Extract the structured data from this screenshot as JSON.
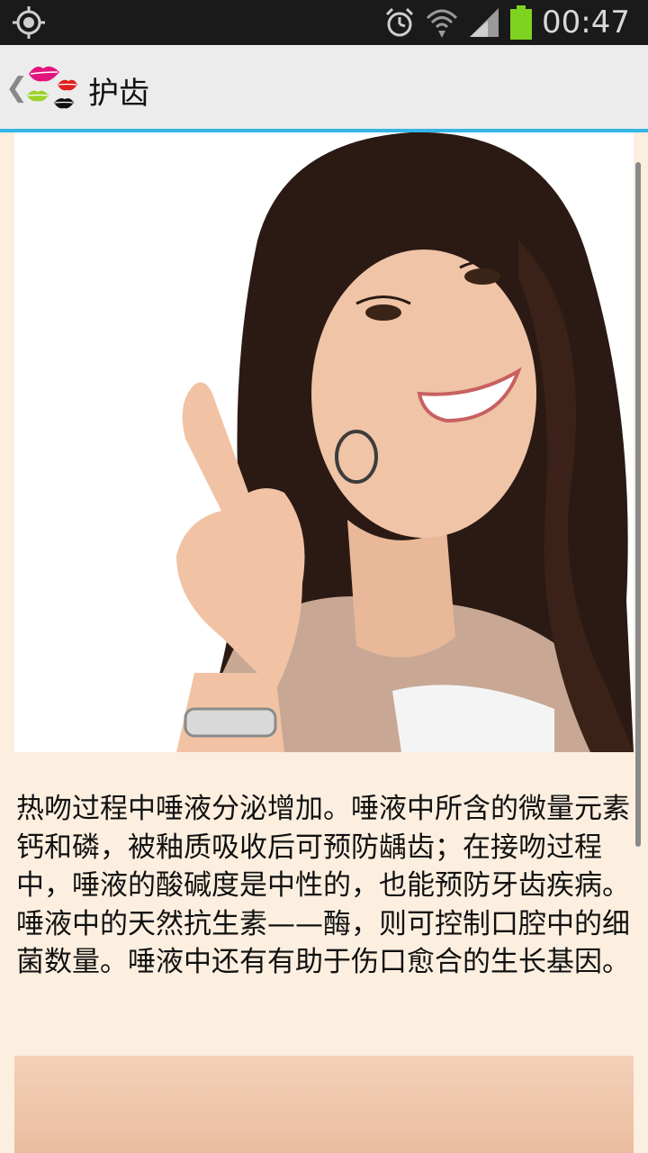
{
  "status_bar": {
    "time": "00:47",
    "icons": [
      "gps-icon",
      "alarm-icon",
      "wifi-icon",
      "signal-icon",
      "battery-icon"
    ],
    "battery_color": "#7ed321"
  },
  "action_bar": {
    "title": "护齿",
    "accent_color": "#33b5e5"
  },
  "article": {
    "paragraph": "热吻过程中唾液分泌增加。唾液中所含的微量元素钙和磷，被釉质吸收后可预防龋齿；在接吻过程中，唾液的酸碱度是中性的，也能预防牙齿疾病。唾液中的天然抗生素——酶，则可控制口腔中的细菌数量。唾液中还有有助于伤口愈合的生长基因。"
  }
}
